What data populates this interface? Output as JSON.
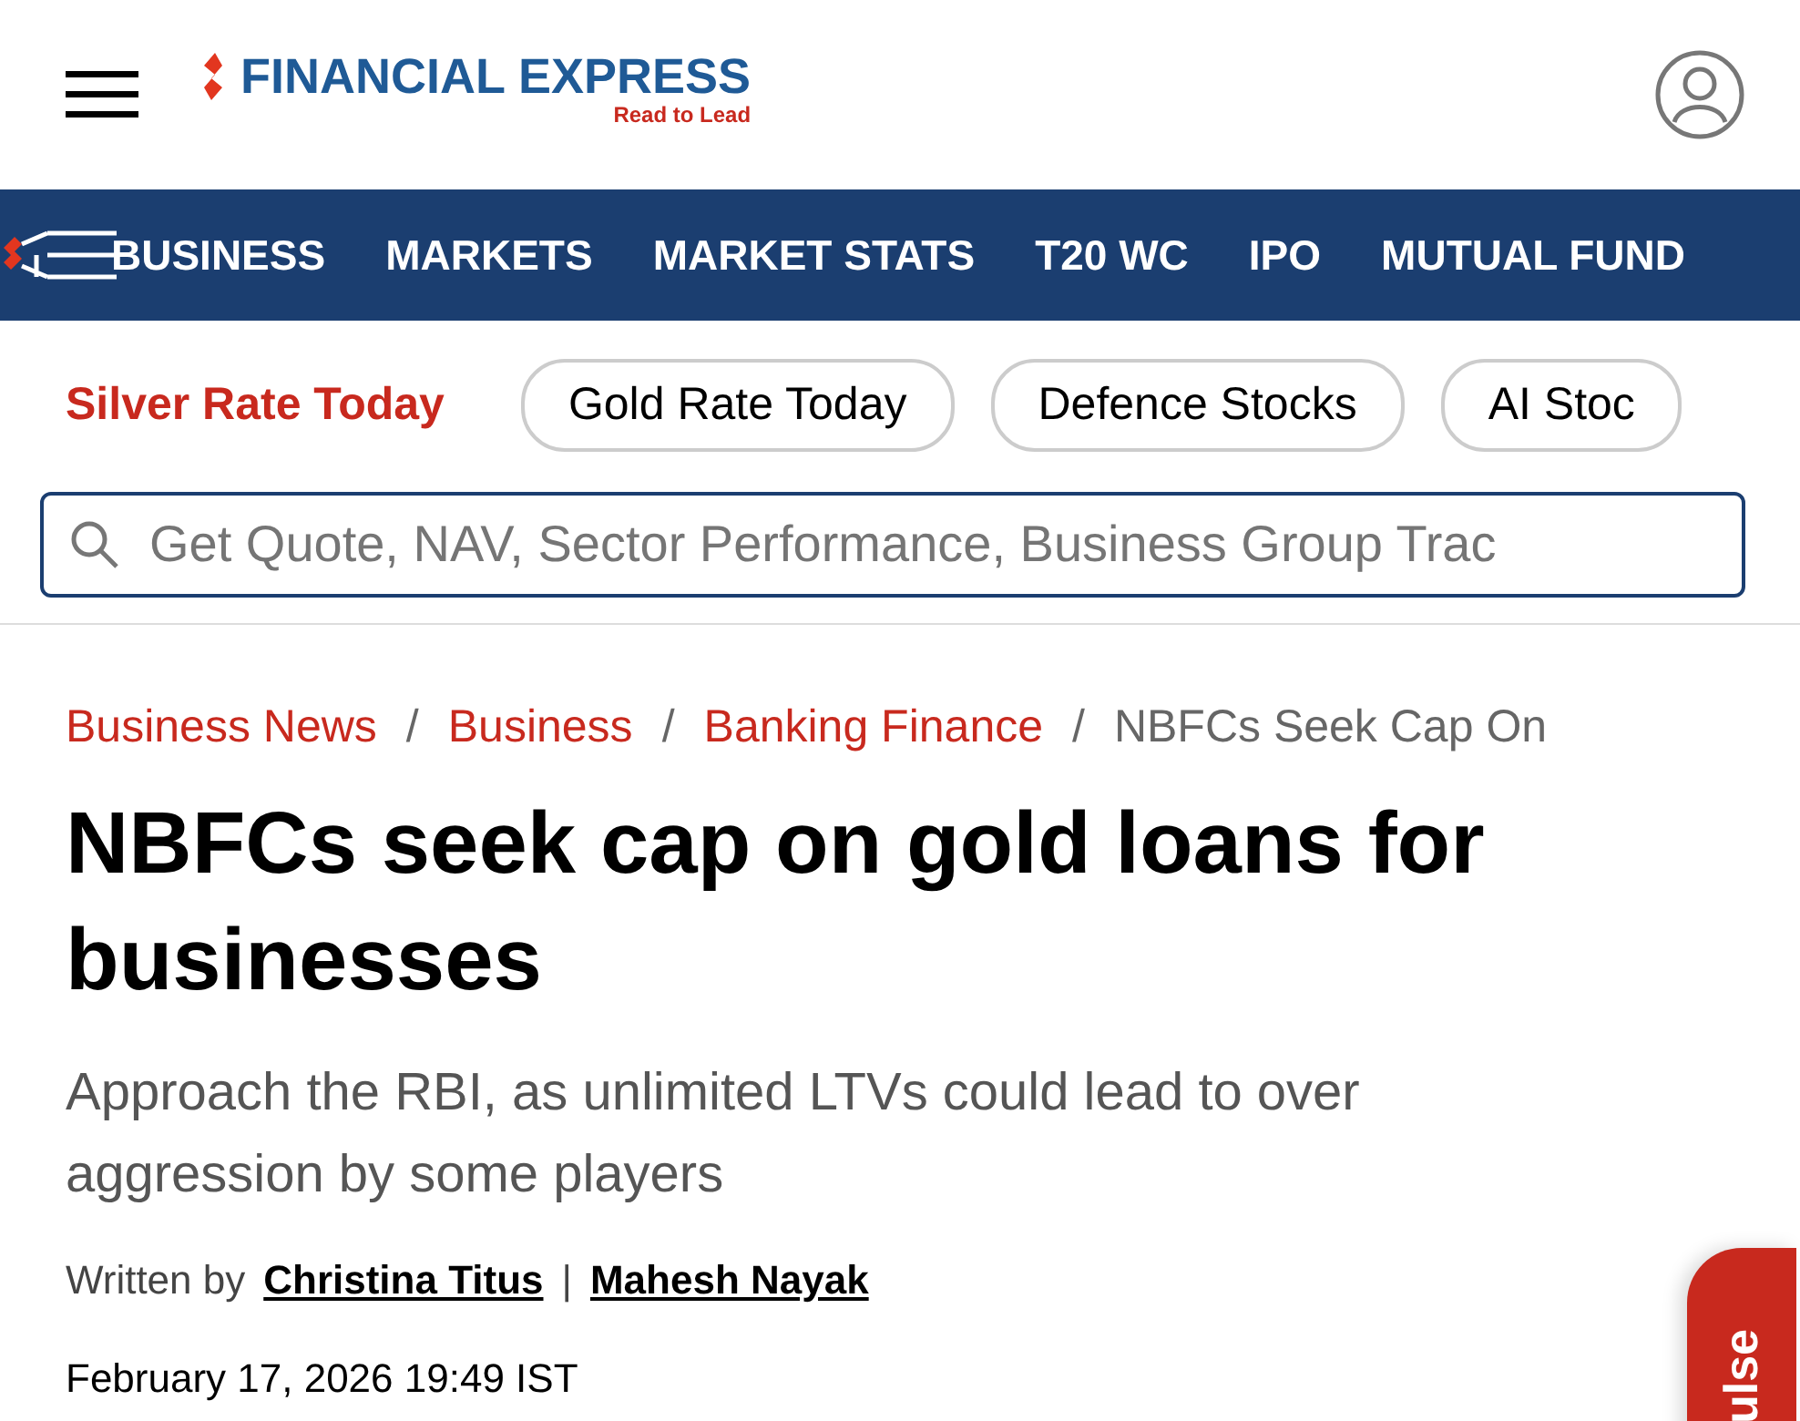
{
  "header": {
    "logo_name": "FINANCIAL EXPRESS",
    "logo_tagline": "Read to Lead"
  },
  "nav": [
    {
      "label": "BUSINESS"
    },
    {
      "label": "MARKETS"
    },
    {
      "label": "MARKET STATS"
    },
    {
      "label": "T20 WC"
    },
    {
      "label": "IPO"
    },
    {
      "label": "MUTUAL FUND"
    }
  ],
  "topics": [
    {
      "label": "Silver Rate Today",
      "kind": "featured"
    },
    {
      "label": "Gold Rate Today",
      "kind": "pill"
    },
    {
      "label": "Defence Stocks",
      "kind": "pill"
    },
    {
      "label": "AI Stoc",
      "kind": "pill"
    }
  ],
  "search": {
    "placeholder": "Get Quote, NAV, Sector Performance, Business Group Trac"
  },
  "breadcrumbs": [
    {
      "label": "Business News",
      "kind": "link"
    },
    {
      "label": "Business",
      "kind": "link"
    },
    {
      "label": "Banking Finance",
      "kind": "link"
    },
    {
      "label": "NBFCs Seek Cap On",
      "kind": "current"
    }
  ],
  "breadcrumb_separator": "/",
  "article": {
    "headline": "NBFCs seek cap on gold loans for businesses",
    "subtitle": "Approach the RBI, as unlimited LTVs could lead to over aggression by some players",
    "byline_prefix": "Written by",
    "authors": [
      "Christina Titus",
      "Mahesh Nayak"
    ],
    "author_separator": "|",
    "date": "February 17, 2026 19:49 IST"
  },
  "pulse_tab": {
    "label": "ulse"
  }
}
